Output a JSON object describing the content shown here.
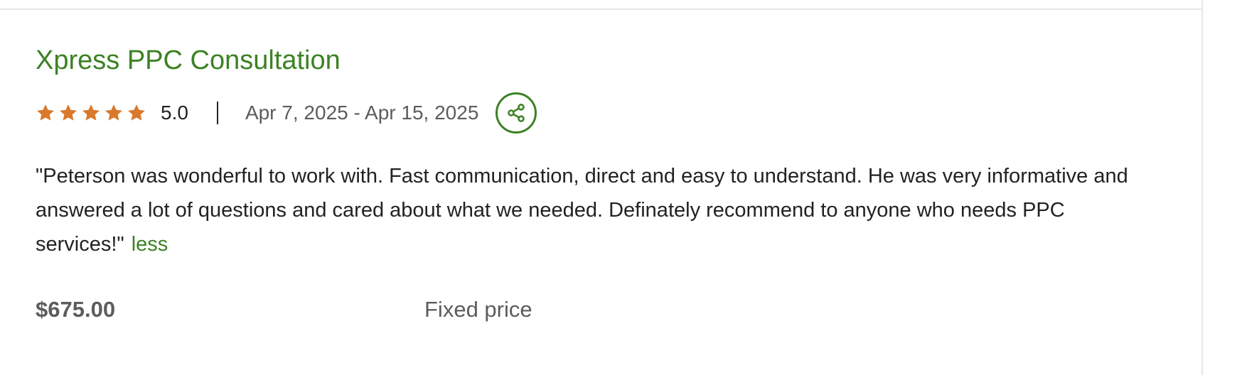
{
  "review": {
    "title": "Xpress PPC Consultation",
    "rating": "5.0",
    "stars_filled": 5,
    "stars_total": 5,
    "date_range": "Apr 7, 2025 - Apr 15, 2025",
    "text": "\"Peterson was wonderful to work with. Fast communication, direct and easy to understand. He was very informative and answered a lot of questions and cared about what we needed. Definately recommend to anyone who needs PPC services!\"",
    "toggle_label": "less",
    "price": "$675.00",
    "price_type": "Fixed price"
  },
  "icons": {
    "star": "star-icon",
    "share": "share-icon"
  },
  "colors": {
    "accent_green": "#3c8224",
    "star_orange": "#d9792b",
    "text_dark": "#222222",
    "text_muted": "#5c5c5c",
    "divider": "#e6e6e6"
  }
}
